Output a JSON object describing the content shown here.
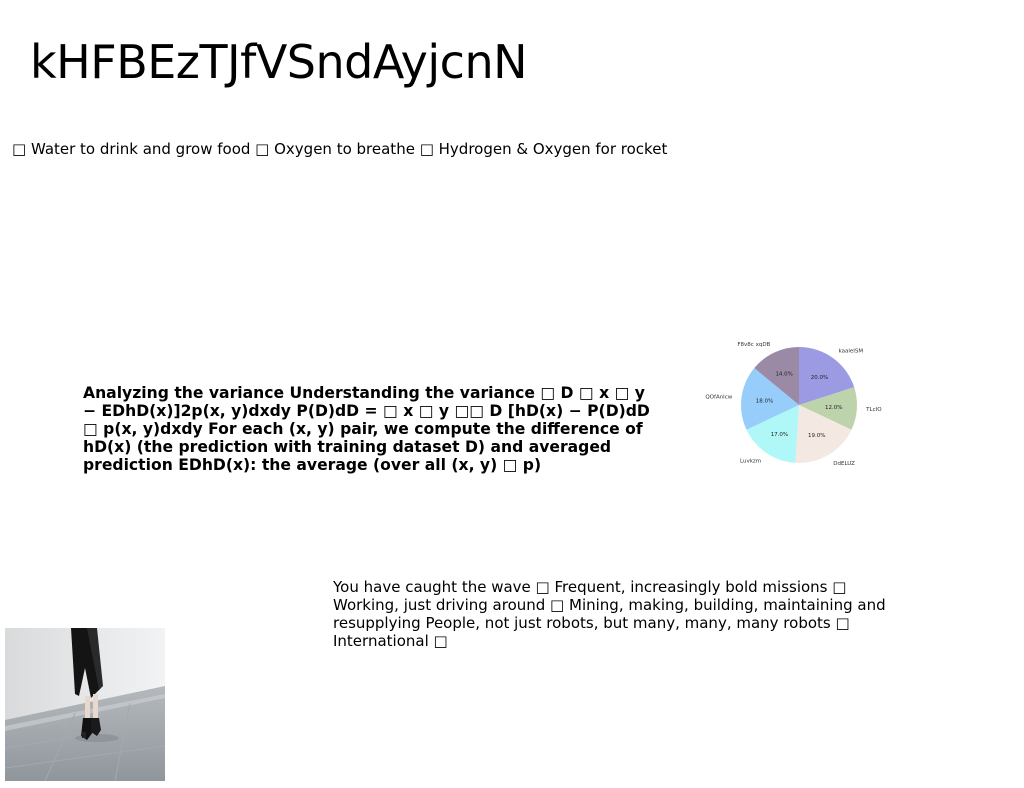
{
  "slide": {
    "title": "kHFBEzTJfVSndAyjcnN",
    "bullets_line": "□ Water to drink and grow food □ Oxygen to breathe □ Hydrogen & Oxygen for rocket",
    "variance_paragraph": "Analyzing the variance Understanding the variance □ D □ x □ y − EDhD(x)]2p(x, y)dxdy P(D)dD = □ x □ y □□ D [hD(x) − P(D)dD □ p(x, y)dxdy For each (x, y) pair, we compute the difference of hD(x) (the prediction with training dataset D) and averaged prediction EDhD(x): the average (over all (x, y) □ p)",
    "wave_paragraph": "You have caught the wave □ Frequent, increasingly bold missions □ Working, just driving around □ Mining, making, building, maintaining and resupplying People, not just robots, but many, many, many robots □ International □"
  },
  "chart_data": {
    "type": "pie",
    "title": "",
    "categories": [
      "kaaleISM",
      "TLcIO",
      "DdELUZ",
      "Luvkzm",
      "QOfAnlcw",
      "F8v8c xqDB"
    ],
    "values": [
      20.0,
      12.0,
      19.0,
      17.0,
      18.0,
      14.0
    ],
    "value_labels": [
      "20.0%",
      "12.0%",
      "19.0%",
      "17.0%",
      "18.0%",
      "14.0%"
    ],
    "colors": [
      "#9c9ae3",
      "#bcd3ab",
      "#f3e9e2",
      "#b0f7f7",
      "#97cdfb",
      "#9b8aa6"
    ],
    "start_angle_deg": 90,
    "direction": "clockwise"
  }
}
